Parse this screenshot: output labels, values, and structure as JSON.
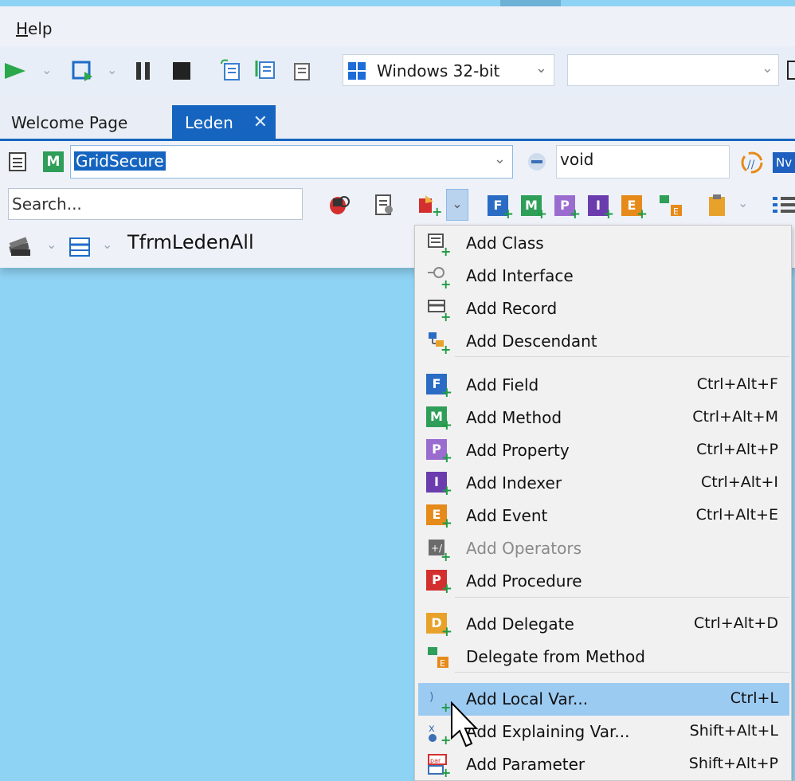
{
  "menubar": {
    "help_label": "Help",
    "help_hotkey": "H"
  },
  "toolbar": {
    "platform": "Windows 32-bit",
    "configuration": ""
  },
  "tabs": [
    {
      "label": "Welcome Page",
      "active": false
    },
    {
      "label": "Leden",
      "active": true
    }
  ],
  "navigator": {
    "type_value": "GridSecure",
    "member_value": "void"
  },
  "search": {
    "placeholder": "Search..."
  },
  "structure": {
    "label": "TfrmLedenAll"
  },
  "colors": {
    "accent": "#1565c0",
    "field": "#2a6bc4",
    "method": "#2e9e58",
    "property": "#9a6cd0",
    "indexer": "#6b3cae",
    "event": "#e68a1a",
    "procedure": "#d32f2f",
    "delegate": "#e8a22c",
    "highlight": "#9ccbf2"
  },
  "menu": {
    "groups": [
      [
        {
          "label": "Add Class",
          "shortcut": "",
          "icon": "class-icon"
        },
        {
          "label": "Add Interface",
          "shortcut": "",
          "icon": "interface-icon"
        },
        {
          "label": "Add Record",
          "shortcut": "",
          "icon": "record-icon"
        },
        {
          "label": "Add Descendant",
          "shortcut": "",
          "icon": "descendant-icon"
        }
      ],
      [
        {
          "label": "Add Field",
          "shortcut": "Ctrl+Alt+F",
          "icon": "field-icon"
        },
        {
          "label": "Add Method",
          "shortcut": "Ctrl+Alt+M",
          "icon": "method-icon"
        },
        {
          "label": "Add Property",
          "shortcut": "Ctrl+Alt+P",
          "icon": "property-icon"
        },
        {
          "label": "Add Indexer",
          "shortcut": "Ctrl+Alt+I",
          "icon": "indexer-icon"
        },
        {
          "label": "Add Event",
          "shortcut": "Ctrl+Alt+E",
          "icon": "event-icon"
        },
        {
          "label": "Add Operators",
          "shortcut": "",
          "icon": "operators-icon",
          "disabled": true
        },
        {
          "label": "Add Procedure",
          "shortcut": "",
          "icon": "procedure-icon"
        }
      ],
      [
        {
          "label": "Add Delegate",
          "shortcut": "Ctrl+Alt+D",
          "icon": "delegate-icon"
        },
        {
          "label": "Delegate from Method",
          "shortcut": "",
          "icon": "delegate-from-method-icon"
        }
      ],
      [
        {
          "label": "Add Local Var...",
          "shortcut": "Ctrl+L",
          "icon": "local-var-icon",
          "selected": true
        },
        {
          "label": "Add Explaining Var...",
          "shortcut": "Shift+Alt+L",
          "icon": "explaining-var-icon"
        },
        {
          "label": "Add Parameter",
          "shortcut": "Shift+Alt+P",
          "icon": "parameter-icon"
        }
      ]
    ]
  }
}
